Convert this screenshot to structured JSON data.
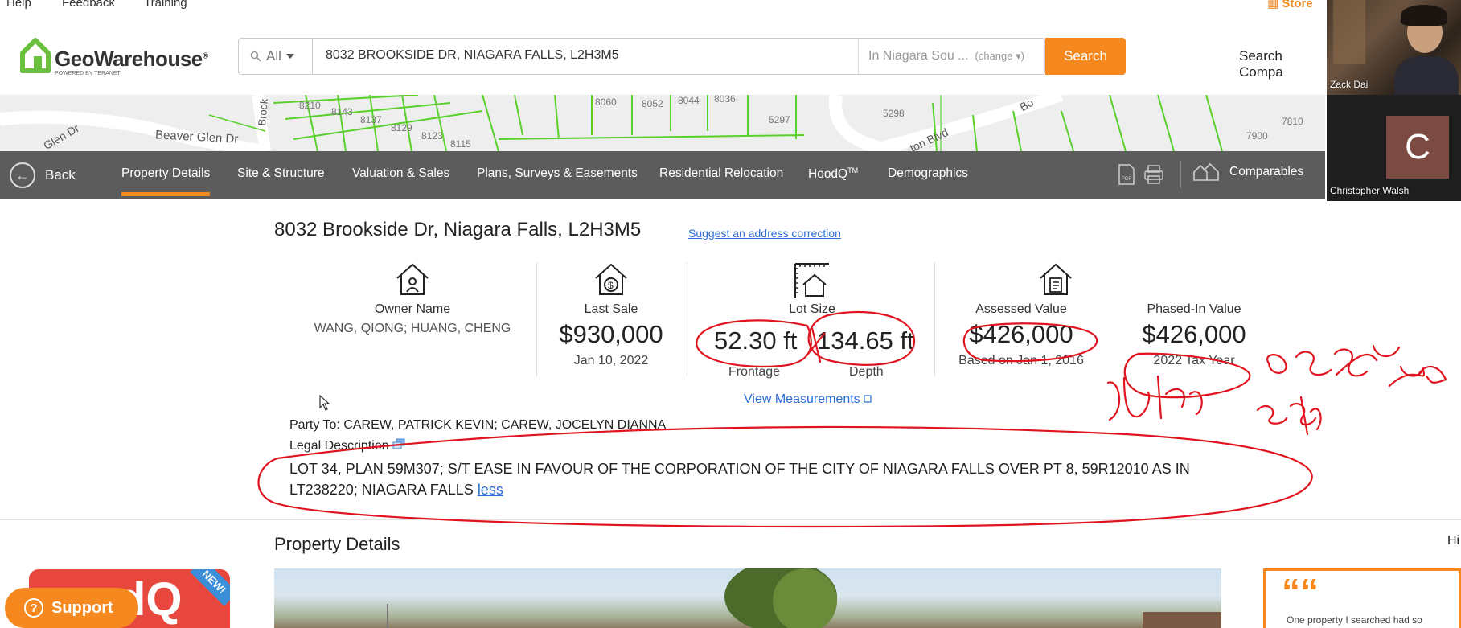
{
  "utility": {
    "help": "Help",
    "feedback": "Feedback",
    "training": "Training",
    "store": "Store"
  },
  "header": {
    "logo": "GeoWarehouse",
    "logo_sub": "POWERED BY TERANET",
    "search_scope_label": "All",
    "search_value": "8032 BROOKSIDE DR, NIAGARA FALLS, L2H3M5",
    "search_region": "In Niagara Sou ...",
    "search_region_change": "(change ▾)",
    "search_button": "Search",
    "search_comparables": "Search Compa"
  },
  "map": {
    "labels": [
      "8210",
      "8143",
      "8137",
      "8129",
      "8123",
      "8115",
      "8060",
      "8052",
      "8044",
      "8036",
      "5297",
      "5298",
      "7900",
      "7810",
      "Beaver Glen Dr",
      "Glen Dr",
      "Brook",
      "ton Blvd",
      "Bo"
    ]
  },
  "nav": {
    "back": "Back",
    "tabs": [
      "Property Details",
      "Site & Structure",
      "Valuation & Sales",
      "Plans, Surveys & Easements",
      "Residential Relocation",
      "HoodQ",
      "Demographics"
    ],
    "hoodq_tm": "TM",
    "comparables": "Comparables"
  },
  "video": {
    "person1": "Zack Dai",
    "person2": "Christopher Walsh",
    "person2_initial": "C"
  },
  "property": {
    "address": "8032 Brookside Dr, Niagara Falls, L2H3M5",
    "suggest_link": "Suggest an address correction",
    "owner_label": "Owner Name",
    "owner_value": "WANG, QIONG; HUANG, CHENG",
    "last_sale_label": "Last Sale",
    "last_sale_value": "$930,000",
    "last_sale_date": "Jan 10, 2022",
    "lot_size_label": "Lot Size",
    "frontage_value": "52.30 ft",
    "frontage_label": "Frontage",
    "depth_value": "134.65 ft",
    "depth_label": "Depth",
    "assessed_label": "Assessed Value",
    "assessed_value": "$426,000",
    "assessed_basis": "Based on Jan 1, 2016",
    "phased_label": "Phased-In Value",
    "phased_value": "$426,000",
    "phased_year": "2022 Tax Year",
    "view_measurements": "View Measurements",
    "party_to": "Party To: CAREW, PATRICK KEVIN; CAREW, JOCELYN DIANNA",
    "legal_label": "Legal Description",
    "legal_text": "LOT 34, PLAN 59M307; S/T EASE IN FAVOUR OF THE CORPORATION OF THE CITY OF NIAGARA FALLS OVER PT 8, 59R12010 AS IN LT238220; NIAGARA FALLS",
    "legal_less": "less"
  },
  "section": {
    "title": "Property Details",
    "right_partial": "Hi"
  },
  "promo": {
    "hoodq": "dQ",
    "new": "NEW!",
    "support": "Support",
    "quote_mark": "““",
    "quote": "One property I searched had so"
  },
  "colors": {
    "accent_orange": "#f5891f",
    "nav_bg": "#5c5c5c",
    "link_blue": "#2d6fd4",
    "annotation_red": "#e0141e",
    "logo_green": "#6cbf3f"
  },
  "icons": [
    "search-icon",
    "chevron-down-icon",
    "back-arrow-icon",
    "pdf-icon",
    "print-icon",
    "comparables-icon",
    "owner-house-icon",
    "sale-house-icon",
    "lot-size-icon",
    "assessed-house-icon",
    "external-link-icon",
    "copy-icon",
    "question-icon"
  ]
}
